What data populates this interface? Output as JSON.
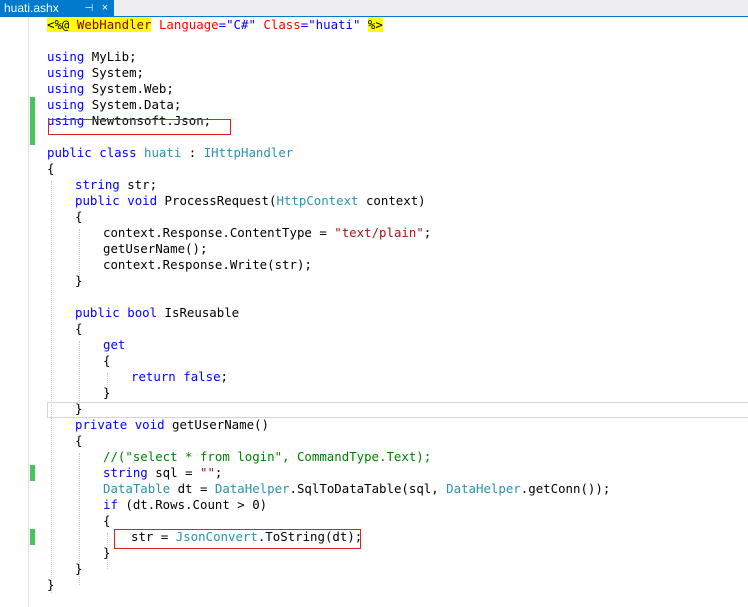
{
  "tab": {
    "title": "huati.ashx",
    "pin": "⊣",
    "close": "×"
  },
  "colors": {
    "keyword": "#0000ff",
    "type": "#2b91af",
    "string": "#a31515",
    "comment": "#008000",
    "accent": "#007acc",
    "highlight": "#e02020",
    "change": "#4cc25a"
  },
  "code": {
    "l1": {
      "open": "<%@",
      "sp1": " ",
      "dir": "WebHandler",
      "sp2": " ",
      "a1": "Language",
      "eq1": "=",
      "v1": "\"C#\"",
      "sp3": " ",
      "a2": "Class",
      "eq2": "=",
      "v2": "\"huati\"",
      "sp4": " ",
      "close": "%>"
    },
    "l3": {
      "kw": "using",
      "rest": " MyLib;"
    },
    "l4": {
      "kw": "using",
      "rest": " System;"
    },
    "l5": {
      "kw": "using",
      "rest": " System.Web;"
    },
    "l6": {
      "kw": "using",
      "rest": " System.Data;"
    },
    "l7": {
      "kw": "using",
      "rest": " Newtonsoft.Json;"
    },
    "l9": {
      "kw1": "public",
      "kw2": "class",
      "name": "huati",
      "colon": " : ",
      "iface": "IHttpHandler"
    },
    "l10": {
      "text": "{"
    },
    "l11": {
      "kw": "string",
      "rest": " str;"
    },
    "l12": {
      "kw1": "public",
      "kw2": "void",
      "name": " ProcessRequest(",
      "type": "HttpContext",
      "rest": " context)"
    },
    "l13": {
      "text": "{"
    },
    "l14": {
      "pre": "context.Response.ContentType = ",
      "str": "\"text/plain\"",
      "post": ";"
    },
    "l15": {
      "text": "getUserName();"
    },
    "l16": {
      "text": "context.Response.Write(str);"
    },
    "l17": {
      "text": "}"
    },
    "l19": {
      "kw1": "public",
      "kw2": "bool",
      "rest": " IsReusable"
    },
    "l20": {
      "text": "{"
    },
    "l21": {
      "kw": "get"
    },
    "l22": {
      "text": "{"
    },
    "l23": {
      "kw1": "return",
      "kw2": "false",
      "post": ";"
    },
    "l24": {
      "text": "}"
    },
    "l25": {
      "text": "}"
    },
    "l26": {
      "kw1": "private",
      "kw2": "void",
      "rest": " getUserName()"
    },
    "l27": {
      "text": "{"
    },
    "l28": {
      "text": "//(\"select * from login\", CommandType.Text);"
    },
    "l29": {
      "kw": "string",
      "mid": " sql = ",
      "str": "\"\"",
      "post": ";"
    },
    "l30": {
      "t1": "DataTable",
      "mid1": " dt = ",
      "t2": "DataHelper",
      "mid2": ".SqlToDataTable(sql, ",
      "t3": "DataHelper",
      "post": ".getConn());"
    },
    "l31": {
      "kw": "if",
      "rest": " (dt.Rows.Count > 0)"
    },
    "l32": {
      "text": "{"
    },
    "l33": {
      "pre": "str = ",
      "type": "JsonConvert",
      "post": ".ToString(dt);"
    },
    "l34": {
      "text": "}"
    },
    "l35": {
      "text": "}"
    },
    "l36": {
      "text": "}"
    }
  }
}
